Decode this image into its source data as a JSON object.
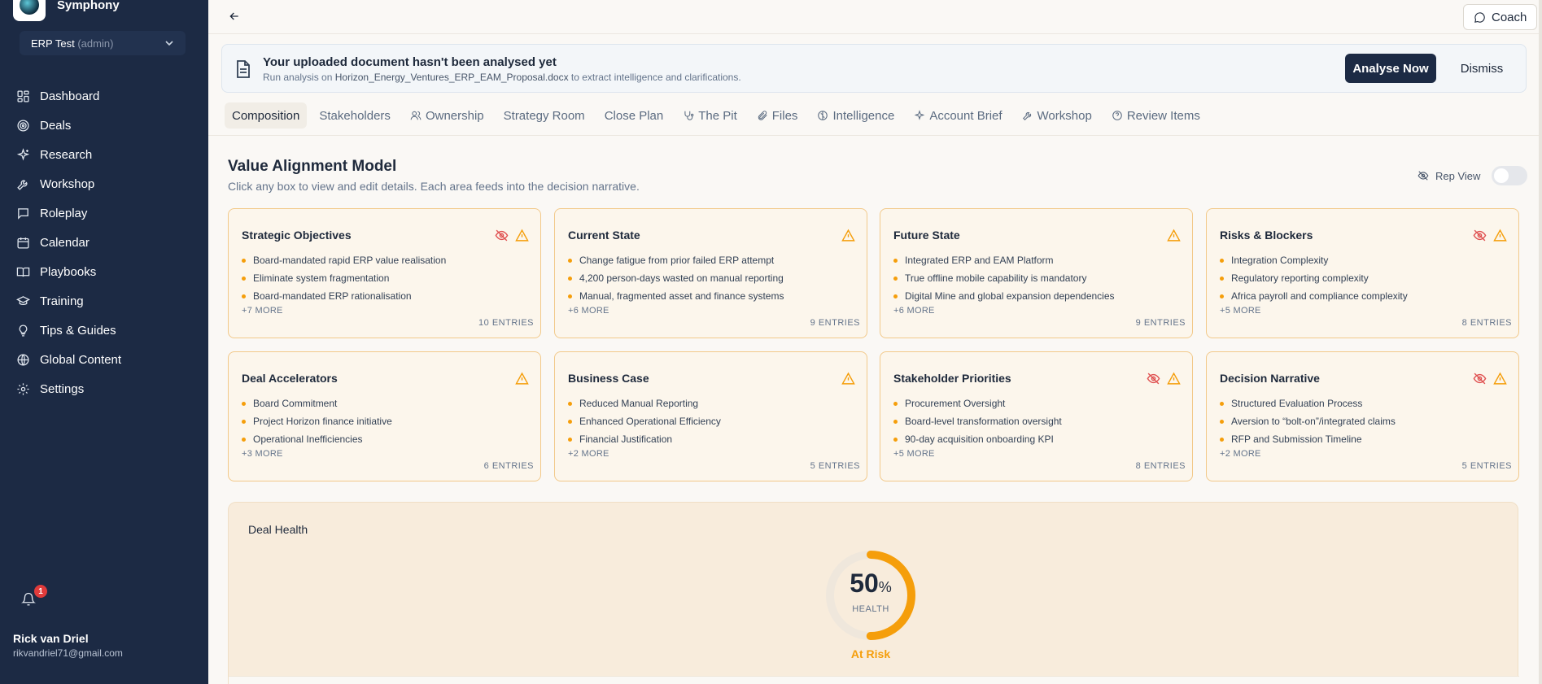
{
  "app": {
    "name": "Symphony"
  },
  "workspace": {
    "name": "ERP Test",
    "role": "(admin)"
  },
  "nav": [
    {
      "label": "Dashboard",
      "icon": "dashboard-icon"
    },
    {
      "label": "Deals",
      "icon": "target-icon"
    },
    {
      "label": "Research",
      "icon": "sparkle-icon"
    },
    {
      "label": "Workshop",
      "icon": "wrench-icon"
    },
    {
      "label": "Roleplay",
      "icon": "chat-icon"
    },
    {
      "label": "Calendar",
      "icon": "calendar-icon"
    },
    {
      "label": "Playbooks",
      "icon": "book-icon"
    },
    {
      "label": "Training",
      "icon": "graduation-cap-icon"
    },
    {
      "label": "Tips & Guides",
      "icon": "lightbulb-icon"
    },
    {
      "label": "Global Content",
      "icon": "globe-icon"
    },
    {
      "label": "Settings",
      "icon": "gear-icon"
    }
  ],
  "notifications": {
    "count": "1"
  },
  "user": {
    "name": "Rick van Driel",
    "email": "rikvandriel71@gmail.com"
  },
  "topbar": {
    "coach_label": "Coach"
  },
  "banner": {
    "title": "Your uploaded document hasn't been analysed yet",
    "sub_prefix": "Run analysis on",
    "file": "Horizon_Energy_Ventures_ERP_EAM_Proposal.docx",
    "sub_suffix": "to extract intelligence and clarifications.",
    "analyse_label": "Analyse Now",
    "dismiss_label": "Dismiss"
  },
  "tabs": [
    {
      "label": "Composition",
      "icon": ""
    },
    {
      "label": "Stakeholders",
      "icon": ""
    },
    {
      "label": "Ownership",
      "icon": "users-icon"
    },
    {
      "label": "Strategy Room",
      "icon": ""
    },
    {
      "label": "Close Plan",
      "icon": ""
    },
    {
      "label": "The Pit",
      "icon": "stethoscope-icon"
    },
    {
      "label": "Files",
      "icon": "paperclip-icon"
    },
    {
      "label": "Intelligence",
      "icon": "brain-icon"
    },
    {
      "label": "Account Brief",
      "icon": "sparkle-icon"
    },
    {
      "label": "Workshop",
      "icon": "wrench-icon"
    },
    {
      "label": "Review Items",
      "icon": "help-circle-icon"
    }
  ],
  "model": {
    "title": "Value Alignment Model",
    "subtitle": "Click any box to view and edit details. Each area feeds into the decision narrative.",
    "rep_view_label": "Rep View"
  },
  "cards": [
    {
      "title": "Strategic Objectives",
      "hidden": true,
      "items": [
        "Board-mandated rapid ERP value realisation",
        "Eliminate system fragmentation",
        "Board-mandated ERP rationalisation"
      ],
      "more": "+7 MORE",
      "count": "10 ENTRIES"
    },
    {
      "title": "Current State",
      "hidden": false,
      "items": [
        "Change fatigue from prior failed ERP attempt",
        "4,200 person-days wasted on manual reporting",
        "Manual, fragmented asset and finance systems"
      ],
      "more": "+6 MORE",
      "count": "9 ENTRIES"
    },
    {
      "title": "Future State",
      "hidden": false,
      "items": [
        "Integrated ERP and EAM Platform",
        "True offline mobile capability is mandatory",
        "Digital Mine and global expansion dependencies"
      ],
      "more": "+6 MORE",
      "count": "9 ENTRIES"
    },
    {
      "title": "Risks & Blockers",
      "hidden": true,
      "items": [
        "Integration Complexity",
        "Regulatory reporting complexity",
        "Africa payroll and compliance complexity"
      ],
      "more": "+5 MORE",
      "count": "8 ENTRIES"
    },
    {
      "title": "Deal Accelerators",
      "hidden": false,
      "items": [
        "Board Commitment",
        "Project Horizon finance initiative",
        "Operational Inefficiencies"
      ],
      "more": "+3 MORE",
      "count": "6 ENTRIES"
    },
    {
      "title": "Business Case",
      "hidden": false,
      "items": [
        "Reduced Manual Reporting",
        "Enhanced Operational Efficiency",
        "Financial Justification"
      ],
      "more": "+2 MORE",
      "count": "5 ENTRIES"
    },
    {
      "title": "Stakeholder Priorities",
      "hidden": true,
      "items": [
        "Procurement Oversight",
        "Board-level transformation oversight",
        "90-day acquisition onboarding KPI"
      ],
      "more": "+5 MORE",
      "count": "8 ENTRIES"
    },
    {
      "title": "Decision Narrative",
      "hidden": true,
      "items": [
        "Structured Evaluation Process",
        "Aversion to “bolt-on”/integrated claims",
        "RFP and Submission Timeline"
      ],
      "more": "+2 MORE",
      "count": "5 ENTRIES"
    }
  ],
  "health": {
    "title": "Deal Health",
    "value": "50",
    "unit": "%",
    "label": "HEALTH",
    "status": "At Risk",
    "fraction": 0.5,
    "color": "#f59e0b"
  }
}
